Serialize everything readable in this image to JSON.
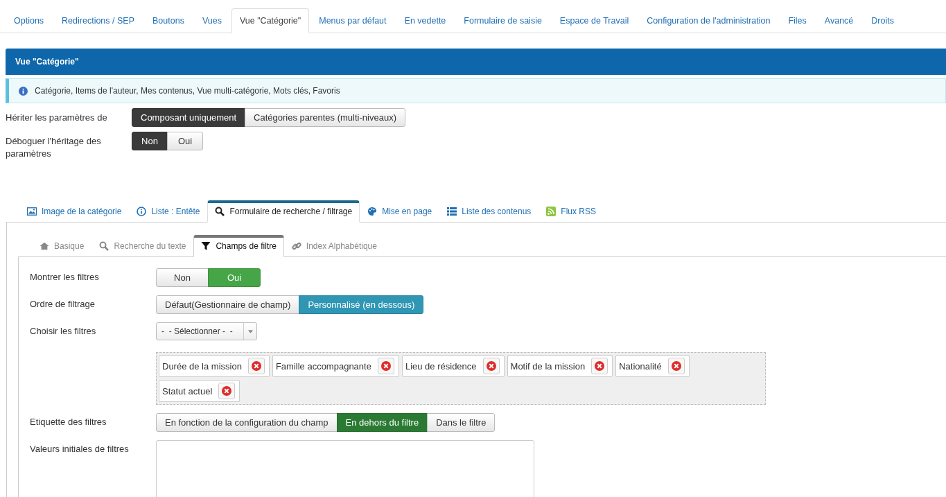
{
  "top_tabs": [
    {
      "label": "Options",
      "selected": false
    },
    {
      "label": "Redirections / SEP",
      "selected": false
    },
    {
      "label": "Boutons",
      "selected": false
    },
    {
      "label": "Vues",
      "selected": false
    },
    {
      "label": "Vue \"Catégorie\"",
      "selected": true
    },
    {
      "label": "Menus par défaut",
      "selected": false
    },
    {
      "label": "En vedette",
      "selected": false
    },
    {
      "label": "Formulaire de saisie",
      "selected": false
    },
    {
      "label": "Espace de Travail",
      "selected": false
    },
    {
      "label": "Configuration de l'administration",
      "selected": false
    },
    {
      "label": "Files",
      "selected": false
    },
    {
      "label": "Avancé",
      "selected": false
    },
    {
      "label": "Droits",
      "selected": false
    }
  ],
  "header": {
    "title": "Vue \"Catégorie\""
  },
  "info": {
    "text": "Catégorie, Items de l'auteur, Mes contenus, Vue multi-catégorie, Mots clés, Favoris"
  },
  "top_fields": [
    {
      "label": "Hériter les paramètres de",
      "options": [
        {
          "label": "Composant uniquement",
          "selected": true
        },
        {
          "label": "Catégories parentes (multi-niveaux)",
          "selected": false
        }
      ]
    },
    {
      "label": "Déboguer l'héritage des paramètres",
      "options": [
        {
          "label": "Non",
          "selected": true
        },
        {
          "label": "Oui",
          "selected": false
        }
      ]
    }
  ],
  "section_tabs": [
    {
      "label": "Image de la catégorie",
      "selected": false
    },
    {
      "label": "Liste : Entête",
      "selected": false
    },
    {
      "label": "Formulaire de recherche / filtrage",
      "selected": true
    },
    {
      "label": "Mise en page",
      "selected": false
    },
    {
      "label": "Liste des contenus",
      "selected": false
    },
    {
      "label": "Flux RSS",
      "selected": false
    }
  ],
  "sub_tabs": [
    {
      "label": "Basique",
      "selected": false
    },
    {
      "label": "Recherche du texte",
      "selected": false
    },
    {
      "label": "Champs de filtre",
      "selected": true
    },
    {
      "label": "Index Alphabétique",
      "selected": false
    }
  ],
  "form": [
    {
      "kind": "toggle",
      "label": "Montrer les filtres",
      "options": [
        {
          "label": "Non",
          "selected": false
        },
        {
          "label": "Oui",
          "selected": true
        }
      ]
    },
    {
      "kind": "toggle",
      "label": "Ordre de filtrage",
      "options": [
        {
          "label": "Défaut(Gestionnaire de champ)",
          "selected": false
        },
        {
          "label": "Personnalisé (en dessous)",
          "selected": true
        }
      ]
    },
    {
      "kind": "select",
      "label": "Choisir les filtres",
      "value": "-  - Sélectionner -  -",
      "tags": [
        "Durée de la mission",
        "Famille accompagnante",
        "Lieu de résidence",
        "Motif de la mission",
        "Nationalité",
        "Statut actuel"
      ]
    },
    {
      "kind": "toggle",
      "label": "Etiquette des filtres",
      "options": [
        {
          "label": "En fonction de la configuration du champ",
          "selected": false
        },
        {
          "label": "En dehors du filtre",
          "selected": true
        },
        {
          "label": "Dans le filtre",
          "selected": false
        }
      ]
    },
    {
      "kind": "textarea",
      "label": "Valeurs initiales de filtres"
    }
  ]
}
